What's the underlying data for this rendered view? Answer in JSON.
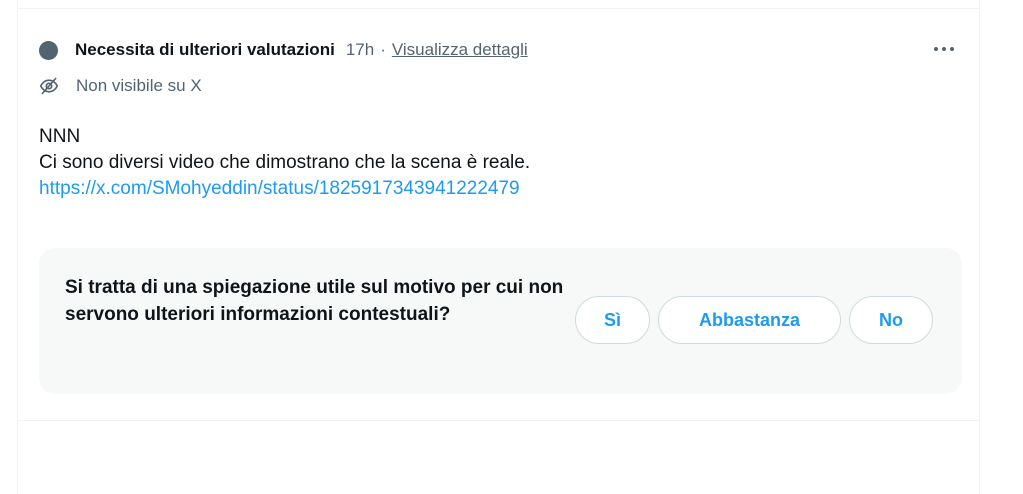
{
  "note": {
    "status_title": "Necessita di ulteriori valutazioni",
    "time": "17h",
    "separator": "·",
    "details_link": "Visualizza dettagli",
    "more_icon": "more-horizontal-icon",
    "visibility_icon": "eye-slash-icon",
    "visibility_text": "Non visibile su X",
    "body_lines": [
      "NNN",
      "Ci sono diversi video che dimostrano che la scena è reale."
    ],
    "link": "https://x.com/SMohyeddin/status/1825917343941222479"
  },
  "rating": {
    "question": "Si tratta di una spiegazione utile sul motivo per cui non servono ulteriori informazioni contestuali?",
    "buttons": [
      "Sì",
      "Abbastanza",
      "No"
    ]
  },
  "colors": {
    "text_primary": "#0f1419",
    "text_secondary": "#536471",
    "accent": "#1d9bf0",
    "panel_bg": "#f7f9f9",
    "border": "#cfd9de"
  }
}
